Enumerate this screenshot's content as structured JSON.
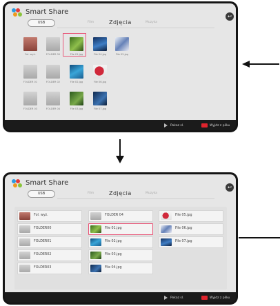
{
  "app": {
    "title": "Smart Share",
    "source_button": "USB",
    "tabs": [
      "Film",
      "Zdjęcia",
      "Muzyka"
    ],
    "active_tab": "Zdjęcia",
    "back_glyph": "↩"
  },
  "footer": {
    "play_label": "Pokaz sl.",
    "back_label": "Wyjdz z pliku"
  },
  "top_grid": {
    "items": [
      {
        "label": "Fol. wyż.",
        "type": "folder-up"
      },
      {
        "label": "FOLDER 00",
        "type": "folder"
      },
      {
        "label": "File 01.jpg",
        "type": "image-forest",
        "selected": true
      },
      {
        "label": "File 04.jpg",
        "type": "image-blue"
      },
      {
        "label": "File 05.jpg",
        "type": "image-flower"
      },
      {
        "label": "FOLDER 01",
        "type": "folder"
      },
      {
        "label": "FOLDER 02",
        "type": "folder"
      },
      {
        "label": "File 02.jpg",
        "type": "image-wave"
      },
      {
        "label": "File 06.jpg",
        "type": "image-berry"
      },
      {
        "label": "FOLDER 03",
        "type": "folder"
      },
      {
        "label": "FOLDER 04",
        "type": "folder"
      },
      {
        "label": "File 03.jpg",
        "type": "image-green2"
      },
      {
        "label": "File 07.jpg",
        "type": "image-blue2"
      }
    ]
  },
  "list_view": {
    "col1": [
      "Fol. wyż.",
      "FOLDER00",
      "FOLDER01",
      "FOLDER02",
      "FOLDER03"
    ],
    "col2": [
      "FOLDER 04",
      "File 01.jpg",
      "File 02.jpg",
      "File 03.jpg",
      "File 04.jpg"
    ],
    "col3": [
      "File 05.jpg",
      "File 06.jpg",
      "File 07.jpg"
    ],
    "selected": "File 01.jpg"
  }
}
